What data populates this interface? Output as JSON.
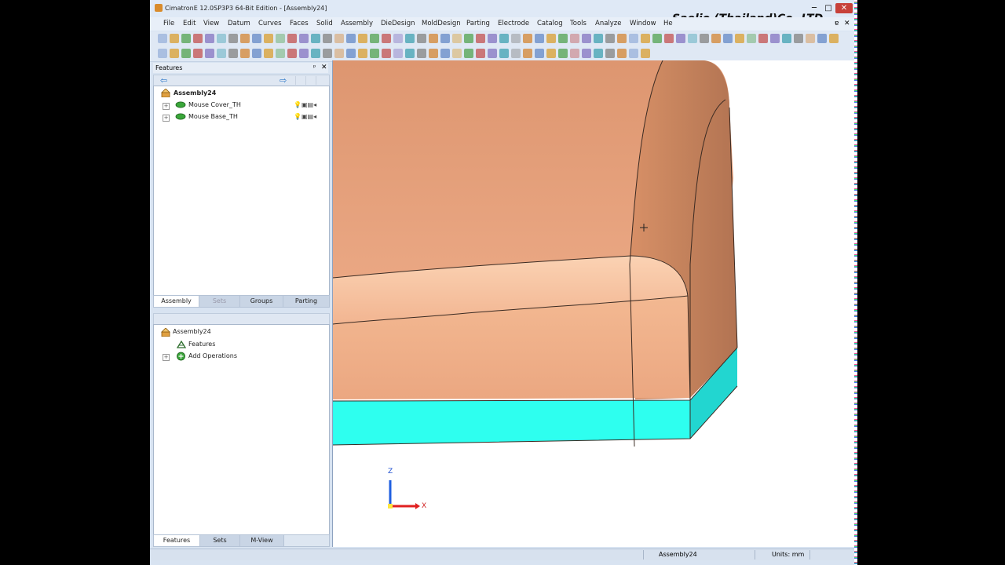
{
  "window": {
    "title": "CimatronE 12.0SP3P3  64-Bit Edition - [Assembly24]",
    "watermark": "Saelio (Thailand)Co.,LTD,",
    "controls": {
      "minimize": "─",
      "maximize": "□",
      "close": "✕"
    }
  },
  "menu": {
    "items": [
      "File",
      "Edit",
      "View",
      "Datum",
      "Curves",
      "Faces",
      "Solid",
      "Assembly",
      "DieDesign",
      "MoldDesign",
      "Parting",
      "Electrode",
      "Catalog",
      "Tools",
      "Analyze",
      "Window",
      "He"
    ],
    "mdi_controls": [
      "ɐ",
      "✕"
    ]
  },
  "colors": {
    "part_orange": "#e9a27d",
    "part_base": "#2effef",
    "panel_bg": "#d8e3f1",
    "tree_icon_green": "#3aa63a"
  },
  "features_panel": {
    "title": "Features",
    "pin": "ᵖ",
    "close": "✕",
    "tree": [
      {
        "label": "Assembly24",
        "level": 0,
        "bold": true,
        "icon": "assembly-icon"
      },
      {
        "label": "Mouse Cover_TH",
        "level": 1,
        "icon": "part-icon"
      },
      {
        "label": "Mouse Base_TH",
        "level": 1,
        "icon": "part-icon"
      }
    ],
    "tabs": [
      {
        "label": "Assembly",
        "active": true
      },
      {
        "label": "Sets",
        "active": false,
        "dim": true
      },
      {
        "label": "Groups",
        "active": false
      },
      {
        "label": "Parting",
        "active": false
      }
    ]
  },
  "lower_panel": {
    "tree": [
      {
        "label": "Assembly24",
        "level": 0,
        "icon": "assembly-icon"
      },
      {
        "label": "Features",
        "level": 1,
        "icon": "features-icon"
      },
      {
        "label": "Add Operations",
        "level": 1,
        "icon": "operations-icon"
      }
    ],
    "tabs": [
      {
        "label": "Features",
        "active": true
      },
      {
        "label": "Sets",
        "active": false
      },
      {
        "label": "M-View",
        "active": false
      }
    ]
  },
  "axis_triad": {
    "z": "Z",
    "x": "X"
  },
  "status": {
    "document": "Assembly24",
    "units": "Units: mm"
  }
}
